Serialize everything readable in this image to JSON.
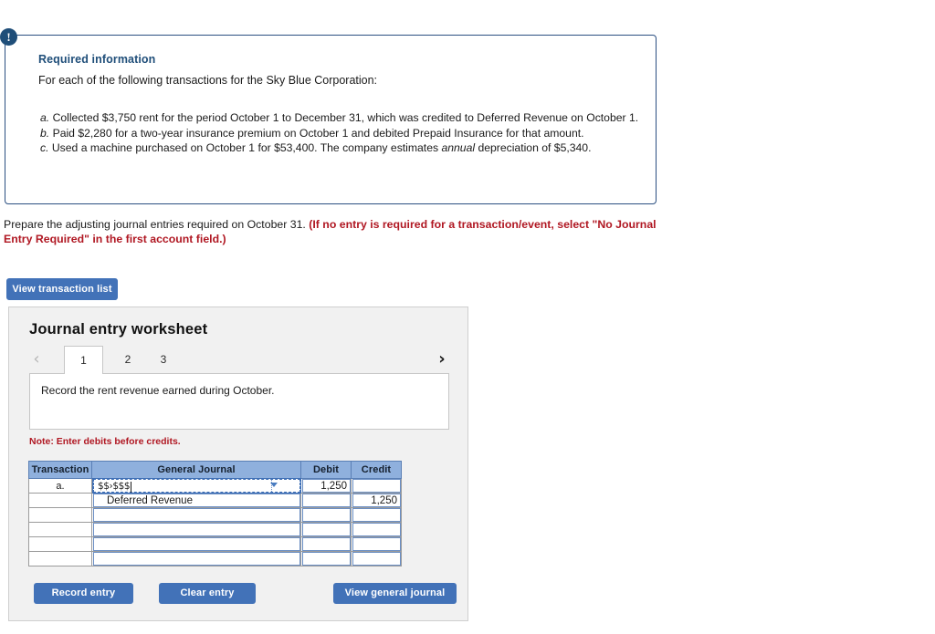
{
  "required_info": {
    "badge_icon": "exclamation-icon",
    "title": "Required information",
    "intro": "For each of the following transactions for the Sky Blue Corporation:",
    "items": [
      {
        "letter": "a.",
        "text": "Collected $3,750 rent for the period October 1 to December 31, which was credited to Deferred Revenue on October 1."
      },
      {
        "letter": "b.",
        "text": "Paid $2,280 for a two-year insurance premium on October 1 and debited Prepaid Insurance for that amount."
      },
      {
        "letter": "c.",
        "text_before": "Used a machine purchased on October 1 for $53,400. The company estimates ",
        "emphasis": "annual",
        "text_after": " depreciation of $5,340."
      }
    ]
  },
  "instruction": {
    "plain": "Prepare the adjusting journal entries required on October 31. ",
    "highlight": "(If no entry is required for a transaction/event, select \"No Journal Entry Required\" in the first account field.)"
  },
  "buttons": {
    "view_transaction_list": "View transaction list",
    "record_entry": "Record entry",
    "clear_entry": "Clear entry",
    "view_general_journal": "View general journal"
  },
  "worksheet": {
    "title": "Journal entry worksheet",
    "prev_arrow": "‹",
    "next_arrow": "›",
    "tabs": [
      {
        "label": "1",
        "active": true
      },
      {
        "label": "2",
        "active": false
      },
      {
        "label": "3",
        "active": false
      }
    ],
    "description": "Record the rent revenue earned during October.",
    "note": "Note: Enter debits before credits."
  },
  "journal_table": {
    "headers": [
      "Transaction",
      "General Journal",
      "Debit",
      "Credit"
    ],
    "rows": [
      {
        "transaction": "a.",
        "account": "$$›$$$",
        "account_selected": true,
        "indent": false,
        "debit": "1,250",
        "credit": ""
      },
      {
        "transaction": "",
        "account": "Deferred Revenue",
        "account_selected": false,
        "indent": true,
        "debit": "",
        "credit": "1,250"
      },
      {
        "transaction": "",
        "account": "",
        "account_selected": false,
        "indent": false,
        "debit": "",
        "credit": ""
      },
      {
        "transaction": "",
        "account": "",
        "account_selected": false,
        "indent": false,
        "debit": "",
        "credit": ""
      },
      {
        "transaction": "",
        "account": "",
        "account_selected": false,
        "indent": false,
        "debit": "",
        "credit": ""
      },
      {
        "transaction": "",
        "account": "",
        "account_selected": false,
        "indent": false,
        "debit": "",
        "credit": ""
      }
    ]
  },
  "colors": {
    "accent_blue": "#4272b8",
    "navy": "#1f4e79",
    "table_header_blue": "#8fb0dd",
    "alert_red": "#b01722",
    "panel_gray": "#f1f1f1"
  }
}
